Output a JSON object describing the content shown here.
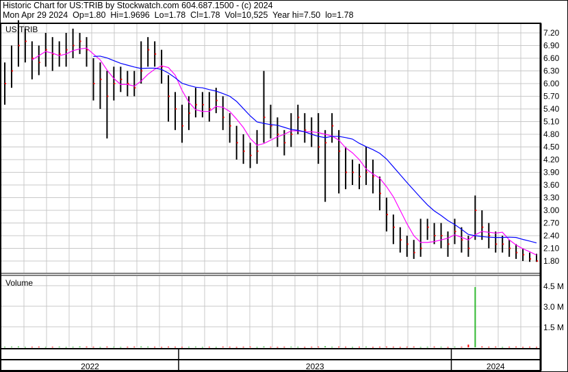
{
  "header": {
    "title": "Historic Chart for US:TRIB by Stockwatch.com 604.687.1500 - (c) 2024",
    "quote": "Mon Apr 29 2024  Op=1.80  Hi=1.9696  Lo=1.78  Cl=1.78  Vol=10,525  Year hi=7.50  lo=1.78"
  },
  "chart_data": {
    "type": "ohlc-bar",
    "symbol": "US:TRIB",
    "price_ticks": [
      "1.80",
      "2.10",
      "2.40",
      "2.70",
      "3.00",
      "3.30",
      "3.60",
      "3.90",
      "4.20",
      "4.50",
      "4.80",
      "5.10",
      "5.40",
      "5.70",
      "6.00",
      "6.30",
      "6.60",
      "6.90",
      "7.20"
    ],
    "ylim": [
      1.62,
      7.5
    ],
    "volume_label": "Volume",
    "volume_ticks": [
      {
        "v": 1.5,
        "label": "1.5 M"
      },
      {
        "v": 3.0,
        "label": "3.0 M"
      },
      {
        "v": 4.5,
        "label": "4.5 M"
      }
    ],
    "volume_ylim": [
      0,
      5.2
    ],
    "years": [
      {
        "label": "2022",
        "start": 0,
        "end": 26
      },
      {
        "label": "2023",
        "start": 26,
        "end": 66
      },
      {
        "label": "2024",
        "start": 66,
        "end": 79
      }
    ],
    "close": [
      6.0,
      6.3,
      6.9,
      7.0,
      6.6,
      6.5,
      6.8,
      6.7,
      6.7,
      6.8,
      6.9,
      7.0,
      6.8,
      6.0,
      6.1,
      5.7,
      6.0,
      6.1,
      6.0,
      5.9,
      6.3,
      6.8,
      6.7,
      6.4,
      5.7,
      5.4,
      5.0,
      5.3,
      5.5,
      5.5,
      5.4,
      5.6,
      5.2,
      5.0,
      4.6,
      4.4,
      4.3,
      4.4,
      5.2,
      5.0,
      4.8,
      4.6,
      4.8,
      5.2,
      4.9,
      4.8,
      4.5,
      4.6,
      5.0,
      4.4,
      3.9,
      3.9,
      3.8,
      3.9,
      3.8,
      3.4,
      2.9,
      2.6,
      2.3,
      2.2,
      2.0,
      2.1,
      2.6,
      2.4,
      2.4,
      2.2,
      2.5,
      2.3,
      2.1,
      3.0,
      2.6,
      2.4,
      2.2,
      2.2,
      2.1,
      2.0,
      1.95,
      1.85,
      1.8
    ],
    "high": [
      6.5,
      6.9,
      7.5,
      7.3,
      7.0,
      6.9,
      7.2,
      7.1,
      7.0,
      7.2,
      7.3,
      7.2,
      7.1,
      6.6,
      6.5,
      6.3,
      6.4,
      6.4,
      6.3,
      6.3,
      7.0,
      7.1,
      7.0,
      6.8,
      6.2,
      5.8,
      5.5,
      5.7,
      5.9,
      5.8,
      5.8,
      5.9,
      5.7,
      5.3,
      5.0,
      4.8,
      4.6,
      4.9,
      6.3,
      5.5,
      5.2,
      4.9,
      5.3,
      5.5,
      5.3,
      5.2,
      5.3,
      4.9,
      5.3,
      4.9,
      4.5,
      4.2,
      4.1,
      4.5,
      4.2,
      3.8,
      3.3,
      2.9,
      2.6,
      2.4,
      2.3,
      2.8,
      2.8,
      2.7,
      2.7,
      2.5,
      2.8,
      2.6,
      2.4,
      3.35,
      3.0,
      2.7,
      2.5,
      2.4,
      2.3,
      2.2,
      2.1,
      2.0,
      1.97
    ],
    "low": [
      5.5,
      5.9,
      6.4,
      6.5,
      6.1,
      6.2,
      6.4,
      6.3,
      6.4,
      6.4,
      6.6,
      6.7,
      6.4,
      5.6,
      5.4,
      4.7,
      5.6,
      5.8,
      5.7,
      5.7,
      6.0,
      6.4,
      6.4,
      6.0,
      5.1,
      4.9,
      4.6,
      4.9,
      5.2,
      5.2,
      5.1,
      5.3,
      4.9,
      4.6,
      4.2,
      4.1,
      4.0,
      4.1,
      4.6,
      4.7,
      4.5,
      4.3,
      4.5,
      4.8,
      4.6,
      4.5,
      4.1,
      3.2,
      4.6,
      3.4,
      3.5,
      3.6,
      3.5,
      3.6,
      3.4,
      3.0,
      2.5,
      2.2,
      2.0,
      1.9,
      1.85,
      1.9,
      2.3,
      2.2,
      2.1,
      1.9,
      2.2,
      2.0,
      1.9,
      2.3,
      2.3,
      2.1,
      2.0,
      2.0,
      1.9,
      1.85,
      1.8,
      1.78,
      1.78
    ],
    "volume": [
      0.04,
      0.05,
      0.06,
      0.03,
      0.04,
      0.05,
      0.03,
      0.04,
      0.05,
      0.03,
      0.04,
      0.06,
      0.05,
      0.04,
      0.03,
      0.05,
      0.04,
      0.03,
      0.04,
      0.05,
      0.06,
      0.05,
      0.04,
      0.03,
      0.05,
      0.04,
      0.03,
      0.04,
      0.05,
      0.03,
      0.04,
      0.03,
      0.05,
      0.04,
      0.03,
      0.04,
      0.05,
      0.03,
      0.06,
      0.04,
      0.03,
      0.04,
      0.05,
      0.04,
      0.03,
      0.04,
      0.05,
      0.08,
      0.04,
      0.05,
      0.04,
      0.03,
      0.04,
      0.05,
      0.03,
      0.04,
      0.05,
      0.04,
      0.03,
      0.04,
      0.05,
      0.03,
      0.04,
      0.05,
      0.04,
      0.03,
      0.05,
      0.04,
      0.2,
      4.4,
      0.06,
      0.04,
      0.05,
      0.03,
      0.04,
      0.05,
      0.03,
      0.04,
      0.03
    ],
    "ma_periods": [
      5,
      14
    ],
    "colors": {
      "bar": "#000000",
      "close_tick": "#ff0000",
      "ma_short": "#ff00ff",
      "ma_long": "#0000ff",
      "vol_up": "#33bb33",
      "vol_down": "#ff0000",
      "grid": "#c8c8c8"
    }
  }
}
